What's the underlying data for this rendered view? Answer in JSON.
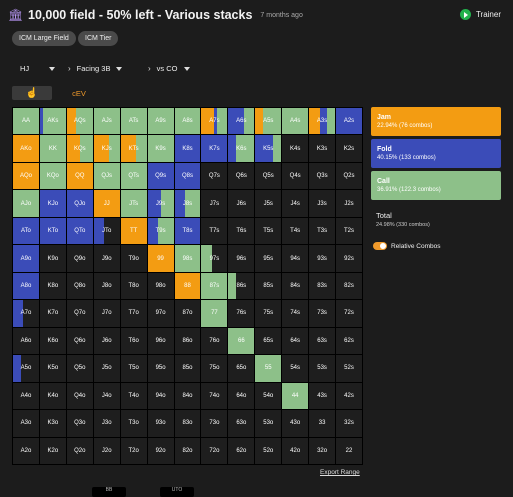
{
  "header": {
    "title": "10,000 field - 50% left - Various stacks",
    "subtitle": "7 months ago",
    "icon": "bank-icon",
    "trainer_label": "Trainer"
  },
  "chips": [
    "ICM Large Field",
    "ICM Tier"
  ],
  "selectors": {
    "position": "HJ",
    "facing": "Facing 3B",
    "versus": "vs CO"
  },
  "tabs": [
    "",
    "cEV"
  ],
  "legend": {
    "jam": {
      "label": "Jam",
      "detail": "22.94% (76 combos)",
      "color": "#f39c12"
    },
    "fold": {
      "label": "Fold",
      "detail": "40.15% (133 combos)",
      "color": "#3b4cb8"
    },
    "call": {
      "label": "Call",
      "detail": "36.91% (122.3 combos)",
      "color": "#8dc089"
    },
    "total_label": "Total",
    "total_detail": "24.98% (330 combos)",
    "relative_combos": "Relative Combos"
  },
  "grid": {
    "labels": [
      [
        "AA",
        "AKs",
        "AQs",
        "AJs",
        "ATs",
        "A9s",
        "A8s",
        "A7s",
        "A6s",
        "A5s",
        "A4s",
        "A3s",
        "A2s"
      ],
      [
        "AKo",
        "KK",
        "KQs",
        "KJs",
        "KTs",
        "K9s",
        "K8s",
        "K7s",
        "K6s",
        "K5s",
        "K4s",
        "K3s",
        "K2s"
      ],
      [
        "AQo",
        "KQo",
        "QQ",
        "QJs",
        "QTs",
        "Q9s",
        "Q8s",
        "Q7s",
        "Q6s",
        "Q5s",
        "Q4s",
        "Q3s",
        "Q2s"
      ],
      [
        "AJo",
        "KJo",
        "QJo",
        "JJ",
        "JTs",
        "J9s",
        "J8s",
        "J7s",
        "J6s",
        "J5s",
        "J4s",
        "J3s",
        "J2s"
      ],
      [
        "ATo",
        "KTo",
        "QTo",
        "JTo",
        "TT",
        "T9s",
        "T8s",
        "T7s",
        "T6s",
        "T5s",
        "T4s",
        "T3s",
        "T2s"
      ],
      [
        "A9o",
        "K9o",
        "Q9o",
        "J9o",
        "T9o",
        "99",
        "98s",
        "97s",
        "96s",
        "95s",
        "94s",
        "93s",
        "92s"
      ],
      [
        "A8o",
        "K8o",
        "Q8o",
        "J8o",
        "T8o",
        "98o",
        "88",
        "87s",
        "86s",
        "85s",
        "84s",
        "83s",
        "82s"
      ],
      [
        "A7o",
        "K7o",
        "Q7o",
        "J7o",
        "T7o",
        "97o",
        "87o",
        "77",
        "76s",
        "75s",
        "74s",
        "73s",
        "72s"
      ],
      [
        "A6o",
        "K6o",
        "Q6o",
        "J6o",
        "T6o",
        "96o",
        "86o",
        "76o",
        "66",
        "65s",
        "64s",
        "63s",
        "62s"
      ],
      [
        "A5o",
        "K5o",
        "Q5o",
        "J5o",
        "T5o",
        "95o",
        "85o",
        "75o",
        "65o",
        "55",
        "54s",
        "53s",
        "52s"
      ],
      [
        "A4o",
        "K4o",
        "Q4o",
        "J4o",
        "T4o",
        "94o",
        "84o",
        "74o",
        "64o",
        "54o",
        "44",
        "43s",
        "42s"
      ],
      [
        "A3o",
        "K3o",
        "Q3o",
        "J3o",
        "T3o",
        "93o",
        "83o",
        "73o",
        "63o",
        "53o",
        "43o",
        "33",
        "32s"
      ],
      [
        "A2o",
        "K2o",
        "Q2o",
        "J2o",
        "T2o",
        "92o",
        "82o",
        "72o",
        "62o",
        "52o",
        "42o",
        "32o",
        "22"
      ]
    ],
    "mix": [
      [
        [
          0,
          0,
          1
        ],
        [
          0,
          0.1,
          0.9
        ],
        [
          0.35,
          0,
          0.65
        ],
        [
          0,
          0,
          1
        ],
        [
          0,
          0,
          1
        ],
        [
          0,
          0,
          1
        ],
        [
          0,
          0,
          1
        ],
        [
          0.5,
          0.1,
          0.4
        ],
        [
          0,
          0.6,
          0.4
        ],
        [
          0.3,
          0,
          0.7
        ],
        [
          0,
          0,
          1
        ],
        [
          0.4,
          0.3,
          0.3
        ],
        [
          0,
          1,
          0
        ]
      ],
      [
        [
          1,
          0,
          0
        ],
        [
          0,
          0,
          1
        ],
        [
          0.5,
          0,
          0.5
        ],
        [
          0.6,
          0,
          0.4
        ],
        [
          0.6,
          0,
          0.4
        ],
        [
          0,
          0,
          1
        ],
        [
          0,
          1,
          0
        ],
        [
          0,
          1,
          0
        ],
        [
          0,
          0.3,
          0.7
        ],
        [
          0,
          0.7,
          0.3
        ],
        [
          0,
          0,
          0
        ],
        [
          0,
          0,
          0
        ],
        [
          0,
          0,
          0
        ]
      ],
      [
        [
          1,
          0,
          0
        ],
        [
          0,
          0,
          1
        ],
        [
          1,
          0,
          0
        ],
        [
          0,
          0,
          1
        ],
        [
          0,
          0,
          1
        ],
        [
          0,
          1,
          0
        ],
        [
          0,
          1,
          0
        ],
        [
          0,
          0,
          0
        ],
        [
          0,
          0,
          0
        ],
        [
          0,
          0,
          0
        ],
        [
          0,
          0,
          0
        ],
        [
          0,
          0,
          0
        ],
        [
          0,
          0,
          0
        ]
      ],
      [
        [
          0,
          0,
          1
        ],
        [
          0,
          1,
          0
        ],
        [
          0,
          1,
          0
        ],
        [
          1,
          0,
          0
        ],
        [
          0,
          0,
          1
        ],
        [
          0,
          0.5,
          0.5
        ],
        [
          0,
          0.4,
          0.6
        ],
        [
          0,
          0,
          0
        ],
        [
          0,
          0,
          0
        ],
        [
          0,
          0,
          0
        ],
        [
          0,
          0,
          0
        ],
        [
          0,
          0,
          0
        ],
        [
          0,
          0,
          0
        ]
      ],
      [
        [
          0,
          1,
          0
        ],
        [
          0,
          1,
          0
        ],
        [
          0,
          1,
          0
        ],
        [
          0,
          0.4,
          0
        ],
        [
          1,
          0,
          0
        ],
        [
          0,
          0.4,
          0.6
        ],
        [
          0,
          1,
          0
        ],
        [
          0,
          0,
          0
        ],
        [
          0,
          0,
          0
        ],
        [
          0,
          0,
          0
        ],
        [
          0,
          0,
          0
        ],
        [
          0,
          0,
          0
        ],
        [
          0,
          0,
          0
        ]
      ],
      [
        [
          0,
          1,
          0
        ],
        [
          0,
          0,
          0
        ],
        [
          0,
          0,
          0
        ],
        [
          0,
          0,
          0
        ],
        [
          0,
          0,
          0
        ],
        [
          1,
          0,
          0
        ],
        [
          0,
          0,
          1
        ],
        [
          0,
          0,
          0.4
        ],
        [
          0,
          0,
          0
        ],
        [
          0,
          0,
          0
        ],
        [
          0,
          0,
          0
        ],
        [
          0,
          0,
          0
        ],
        [
          0,
          0,
          0
        ]
      ],
      [
        [
          0,
          1,
          0
        ],
        [
          0,
          0,
          0
        ],
        [
          0,
          0,
          0
        ],
        [
          0,
          0,
          0
        ],
        [
          0,
          0,
          0
        ],
        [
          0,
          0,
          0
        ],
        [
          1,
          0,
          0
        ],
        [
          0,
          0,
          1
        ],
        [
          0,
          0,
          0.3
        ],
        [
          0,
          0,
          0
        ],
        [
          0,
          0,
          0
        ],
        [
          0,
          0,
          0
        ],
        [
          0,
          0,
          0
        ]
      ],
      [
        [
          0,
          0.4,
          0
        ],
        [
          0,
          0,
          0
        ],
        [
          0,
          0,
          0
        ],
        [
          0,
          0,
          0
        ],
        [
          0,
          0,
          0
        ],
        [
          0,
          0,
          0
        ],
        [
          0,
          0,
          0
        ],
        [
          0,
          0,
          1
        ],
        [
          0,
          0,
          0
        ],
        [
          0,
          0,
          0
        ],
        [
          0,
          0,
          0
        ],
        [
          0,
          0,
          0
        ],
        [
          0,
          0,
          0
        ]
      ],
      [
        [
          0,
          0,
          0
        ],
        [
          0,
          0,
          0
        ],
        [
          0,
          0,
          0
        ],
        [
          0,
          0,
          0
        ],
        [
          0,
          0,
          0
        ],
        [
          0,
          0,
          0
        ],
        [
          0,
          0,
          0
        ],
        [
          0,
          0,
          0
        ],
        [
          0,
          0,
          1
        ],
        [
          0,
          0,
          0
        ],
        [
          0,
          0,
          0
        ],
        [
          0,
          0,
          0
        ],
        [
          0,
          0,
          0
        ]
      ],
      [
        [
          0,
          0.3,
          0
        ],
        [
          0,
          0,
          0
        ],
        [
          0,
          0,
          0
        ],
        [
          0,
          0,
          0
        ],
        [
          0,
          0,
          0
        ],
        [
          0,
          0,
          0
        ],
        [
          0,
          0,
          0
        ],
        [
          0,
          0,
          0
        ],
        [
          0,
          0,
          0
        ],
        [
          0,
          0,
          1
        ],
        [
          0,
          0,
          0
        ],
        [
          0,
          0,
          0
        ],
        [
          0,
          0,
          0
        ]
      ],
      [
        [
          0,
          0,
          0
        ],
        [
          0,
          0,
          0
        ],
        [
          0,
          0,
          0
        ],
        [
          0,
          0,
          0
        ],
        [
          0,
          0,
          0
        ],
        [
          0,
          0,
          0
        ],
        [
          0,
          0,
          0
        ],
        [
          0,
          0,
          0
        ],
        [
          0,
          0,
          0
        ],
        [
          0,
          0,
          0
        ],
        [
          0,
          0,
          1
        ],
        [
          0,
          0,
          0
        ],
        [
          0,
          0,
          0
        ]
      ],
      [
        [
          0,
          0,
          0
        ],
        [
          0,
          0,
          0
        ],
        [
          0,
          0,
          0
        ],
        [
          0,
          0,
          0
        ],
        [
          0,
          0,
          0
        ],
        [
          0,
          0,
          0
        ],
        [
          0,
          0,
          0
        ],
        [
          0,
          0,
          0
        ],
        [
          0,
          0,
          0
        ],
        [
          0,
          0,
          0
        ],
        [
          0,
          0,
          0
        ],
        [
          0,
          0,
          0
        ],
        [
          0,
          0,
          0
        ]
      ],
      [
        [
          0,
          0,
          0
        ],
        [
          0,
          0,
          0
        ],
        [
          0,
          0,
          0
        ],
        [
          0,
          0,
          0
        ],
        [
          0,
          0,
          0
        ],
        [
          0,
          0,
          0
        ],
        [
          0,
          0,
          0
        ],
        [
          0,
          0,
          0
        ],
        [
          0,
          0,
          0
        ],
        [
          0,
          0,
          0
        ],
        [
          0,
          0,
          0
        ],
        [
          0,
          0,
          0
        ],
        [
          0,
          0,
          0
        ]
      ]
    ]
  },
  "export_label": "Export Range",
  "seats": [
    "BB",
    "UTO"
  ]
}
